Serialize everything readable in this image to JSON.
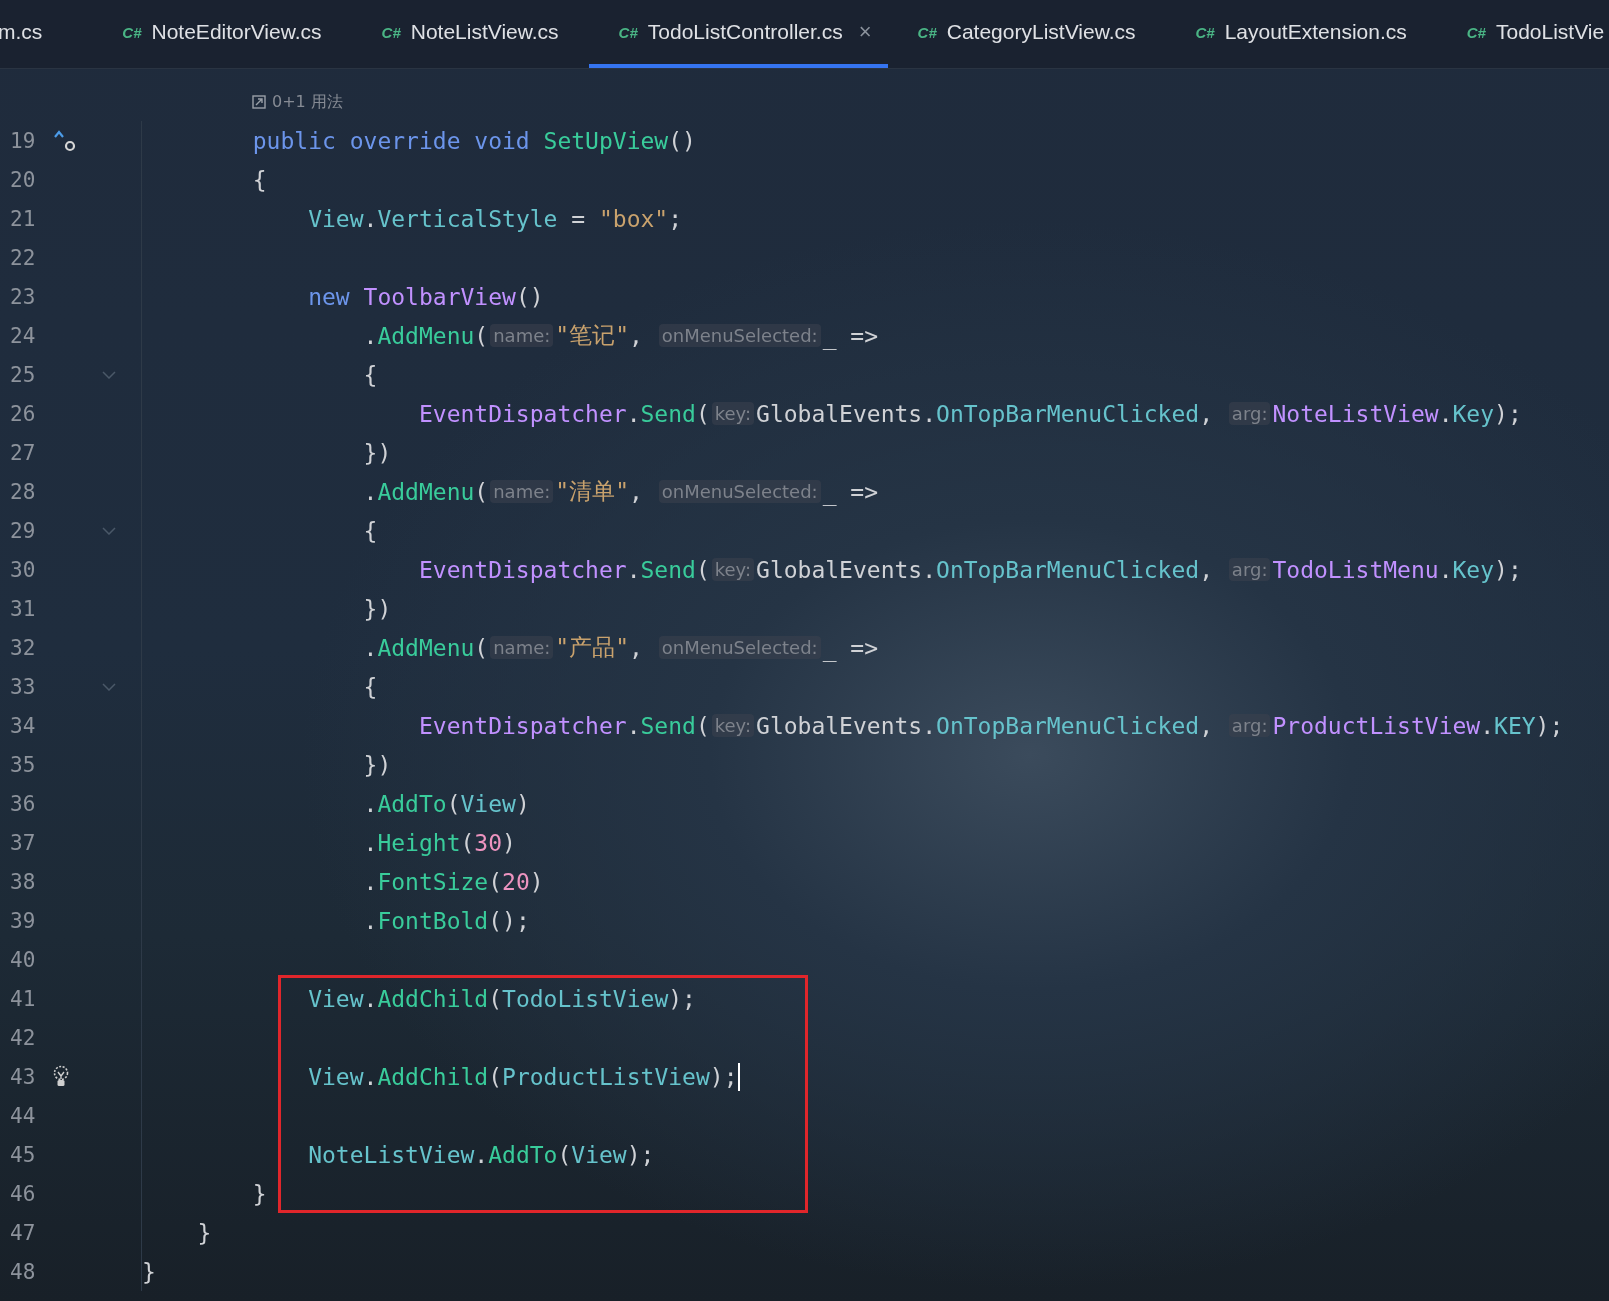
{
  "tabs": [
    {
      "label": "m.cs",
      "selected": false
    },
    {
      "label": "NoteEditorView.cs",
      "badge": "C#",
      "selected": false
    },
    {
      "label": "NoteListView.cs",
      "badge": "C#",
      "selected": false
    },
    {
      "label": "TodoListController.cs",
      "badge": "C#",
      "selected": true,
      "close": "×"
    },
    {
      "label": "CategoryListView.cs",
      "badge": "C#",
      "selected": false
    },
    {
      "label": "LayoutExtension.cs",
      "badge": "C#",
      "selected": false
    },
    {
      "label": "TodoListVie",
      "badge": "C#",
      "selected": false
    }
  ],
  "usage_hint": {
    "text": "0+1 用法"
  },
  "lines": [
    {
      "number": "19",
      "kind": "override",
      "boxed": false,
      "tokens": [
        {
          "kind": "kw",
          "text": "        public override void "
        },
        {
          "kind": "method",
          "text": "SetUpView"
        },
        {
          "kind": "plain",
          "text": "()"
        }
      ]
    },
    {
      "number": "20",
      "kind": "plain",
      "boxed": false,
      "tokens": [
        {
          "kind": "plain",
          "text": "        {"
        }
      ]
    },
    {
      "number": "21",
      "kind": "plain",
      "boxed": false,
      "tokens": [
        {
          "kind": "field",
          "text": "            View"
        },
        {
          "kind": "plain",
          "text": "."
        },
        {
          "kind": "field",
          "text": "VerticalStyle"
        },
        {
          "kind": "plain",
          "text": " = "
        },
        {
          "kind": "str",
          "text": "\"box\""
        },
        {
          "kind": "plain",
          "text": ";"
        }
      ]
    },
    {
      "number": "22",
      "kind": "plain",
      "boxed": false
    },
    {
      "number": "23",
      "kind": "plain",
      "boxed": false,
      "tokens": [
        {
          "kind": "kw",
          "text": "            new "
        },
        {
          "kind": "type",
          "text": "ToolbarView"
        },
        {
          "kind": "plain",
          "text": "()"
        }
      ]
    },
    {
      "number": "24",
      "kind": "plain",
      "boxed": false,
      "tokens": [
        {
          "kind": "plain",
          "text": "                ."
        },
        {
          "kind": "method",
          "text": "AddMenu"
        },
        {
          "kind": "plain",
          "text": "("
        },
        {
          "kind": "hint",
          "text": "name:"
        },
        {
          "kind": "str",
          "text": "\"笔记\""
        },
        {
          "kind": "plain",
          "text": ", "
        },
        {
          "kind": "hint",
          "text": "onMenuSelected:"
        },
        {
          "kind": "plain",
          "text": "_ =>"
        }
      ]
    },
    {
      "number": "25",
      "kind": "fold",
      "boxed": false,
      "tokens": [
        {
          "kind": "plain",
          "text": "                {"
        }
      ]
    },
    {
      "number": "26",
      "kind": "plain",
      "boxed": false,
      "tokens": [
        {
          "kind": "type",
          "text": "                    EventDispatcher"
        },
        {
          "kind": "plain",
          "text": "."
        },
        {
          "kind": "method",
          "text": "Send"
        },
        {
          "kind": "plain",
          "text": "("
        },
        {
          "kind": "hint",
          "text": "key:"
        },
        {
          "kind": "plain",
          "text": "GlobalEvents."
        },
        {
          "kind": "field",
          "text": "OnTopBarMenuClicked"
        },
        {
          "kind": "plain",
          "text": ", "
        },
        {
          "kind": "hint",
          "text": "arg:"
        },
        {
          "kind": "type",
          "text": "NoteListView"
        },
        {
          "kind": "plain",
          "text": "."
        },
        {
          "kind": "field",
          "text": "Key"
        },
        {
          "kind": "plain",
          "text": ");"
        }
      ]
    },
    {
      "number": "27",
      "kind": "plain",
      "boxed": false,
      "tokens": [
        {
          "kind": "plain",
          "text": "                })"
        }
      ]
    },
    {
      "number": "28",
      "kind": "plain",
      "boxed": false,
      "tokens": [
        {
          "kind": "plain",
          "text": "                ."
        },
        {
          "kind": "method",
          "text": "AddMenu"
        },
        {
          "kind": "plain",
          "text": "("
        },
        {
          "kind": "hint",
          "text": "name:"
        },
        {
          "kind": "str",
          "text": "\"清单\""
        },
        {
          "kind": "plain",
          "text": ", "
        },
        {
          "kind": "hint",
          "text": "onMenuSelected:"
        },
        {
          "kind": "plain",
          "text": "_ =>"
        }
      ]
    },
    {
      "number": "29",
      "kind": "fold",
      "boxed": false,
      "tokens": [
        {
          "kind": "plain",
          "text": "                {"
        }
      ]
    },
    {
      "number": "30",
      "kind": "plain",
      "boxed": false,
      "tokens": [
        {
          "kind": "type",
          "text": "                    EventDispatcher"
        },
        {
          "kind": "plain",
          "text": "."
        },
        {
          "kind": "method",
          "text": "Send"
        },
        {
          "kind": "plain",
          "text": "("
        },
        {
          "kind": "hint",
          "text": "key:"
        },
        {
          "kind": "plain",
          "text": "GlobalEvents."
        },
        {
          "kind": "field",
          "text": "OnTopBarMenuClicked"
        },
        {
          "kind": "plain",
          "text": ", "
        },
        {
          "kind": "hint",
          "text": "arg:"
        },
        {
          "kind": "type",
          "text": "TodoListMenu"
        },
        {
          "kind": "plain",
          "text": "."
        },
        {
          "kind": "field",
          "text": "Key"
        },
        {
          "kind": "plain",
          "text": ");"
        }
      ]
    },
    {
      "number": "31",
      "kind": "plain",
      "boxed": false,
      "tokens": [
        {
          "kind": "plain",
          "text": "                })"
        }
      ]
    },
    {
      "number": "32",
      "kind": "plain",
      "boxed": false,
      "tokens": [
        {
          "kind": "plain",
          "text": "                ."
        },
        {
          "kind": "method",
          "text": "AddMenu"
        },
        {
          "kind": "plain",
          "text": "("
        },
        {
          "kind": "hint",
          "text": "name:"
        },
        {
          "kind": "str",
          "text": "\"产品\""
        },
        {
          "kind": "plain",
          "text": ", "
        },
        {
          "kind": "hint",
          "text": "onMenuSelected:"
        },
        {
          "kind": "plain",
          "text": "_ =>"
        }
      ]
    },
    {
      "number": "33",
      "kind": "fold",
      "boxed": false,
      "tokens": [
        {
          "kind": "plain",
          "text": "                {"
        }
      ]
    },
    {
      "number": "34",
      "kind": "plain",
      "boxed": false,
      "tokens": [
        {
          "kind": "type",
          "text": "                    EventDispatcher"
        },
        {
          "kind": "plain",
          "text": "."
        },
        {
          "kind": "method",
          "text": "Send"
        },
        {
          "kind": "plain",
          "text": "("
        },
        {
          "kind": "hint",
          "text": "key:"
        },
        {
          "kind": "plain",
          "text": "GlobalEvents."
        },
        {
          "kind": "field",
          "text": "OnTopBarMenuClicked"
        },
        {
          "kind": "plain",
          "text": ", "
        },
        {
          "kind": "hint",
          "text": "arg:"
        },
        {
          "kind": "type",
          "text": "ProductListView"
        },
        {
          "kind": "plain",
          "text": "."
        },
        {
          "kind": "field",
          "text": "KEY"
        },
        {
          "kind": "plain",
          "text": ");"
        }
      ]
    },
    {
      "number": "35",
      "kind": "plain",
      "boxed": false,
      "tokens": [
        {
          "kind": "plain",
          "text": "                })"
        }
      ]
    },
    {
      "number": "36",
      "kind": "plain",
      "boxed": false,
      "tokens": [
        {
          "kind": "plain",
          "text": "                ."
        },
        {
          "kind": "method",
          "text": "AddTo"
        },
        {
          "kind": "plain",
          "text": "("
        },
        {
          "kind": "field",
          "text": "View"
        },
        {
          "kind": "plain",
          "text": ")"
        }
      ]
    },
    {
      "number": "37",
      "kind": "plain",
      "boxed": false,
      "tokens": [
        {
          "kind": "plain",
          "text": "                ."
        },
        {
          "kind": "method",
          "text": "Height"
        },
        {
          "kind": "plain",
          "text": "("
        },
        {
          "kind": "num",
          "text": "30"
        },
        {
          "kind": "plain",
          "text": ")"
        }
      ]
    },
    {
      "number": "38",
      "kind": "plain",
      "boxed": false,
      "tokens": [
        {
          "kind": "plain",
          "text": "                ."
        },
        {
          "kind": "method",
          "text": "FontSize"
        },
        {
          "kind": "plain",
          "text": "("
        },
        {
          "kind": "num",
          "text": "20"
        },
        {
          "kind": "plain",
          "text": ")"
        }
      ]
    },
    {
      "number": "39",
      "kind": "plain",
      "boxed": false,
      "tokens": [
        {
          "kind": "plain",
          "text": "                ."
        },
        {
          "kind": "method",
          "text": "FontBold"
        },
        {
          "kind": "plain",
          "text": "();"
        }
      ]
    },
    {
      "number": "40",
      "kind": "plain",
      "boxed": false
    },
    {
      "number": "41",
      "kind": "plain",
      "boxed": true,
      "tokens": [
        {
          "kind": "field",
          "text": "            View"
        },
        {
          "kind": "plain",
          "text": "."
        },
        {
          "kind": "method",
          "text": "AddChild"
        },
        {
          "kind": "plain",
          "text": "("
        },
        {
          "kind": "field",
          "text": "TodoListView"
        },
        {
          "kind": "plain",
          "text": ");"
        }
      ]
    },
    {
      "number": "42",
      "kind": "plain",
      "boxed": true
    },
    {
      "number": "43",
      "kind": "bulb",
      "boxed": true,
      "caret": true,
      "tokens": [
        {
          "kind": "field",
          "text": "            View"
        },
        {
          "kind": "plain",
          "text": "."
        },
        {
          "kind": "method",
          "text": "AddChild"
        },
        {
          "kind": "plain",
          "text": "("
        },
        {
          "kind": "field",
          "text": "ProductListView"
        },
        {
          "kind": "plain",
          "text": ");"
        }
      ]
    },
    {
      "number": "44",
      "kind": "plain",
      "boxed": true
    },
    {
      "number": "45",
      "kind": "plain",
      "boxed": true,
      "tokens": [
        {
          "kind": "field",
          "text": "            NoteListView"
        },
        {
          "kind": "plain",
          "text": "."
        },
        {
          "kind": "method",
          "text": "AddTo"
        },
        {
          "kind": "plain",
          "text": "("
        },
        {
          "kind": "field",
          "text": "View"
        },
        {
          "kind": "plain",
          "text": ");"
        }
      ]
    },
    {
      "number": "46",
      "kind": "plain",
      "boxed": true,
      "tokens": [
        {
          "kind": "plain",
          "text": "        }"
        }
      ]
    },
    {
      "number": "47",
      "kind": "plain",
      "boxed": false,
      "tokens": [
        {
          "kind": "plain",
          "text": "    }"
        }
      ]
    },
    {
      "number": "48",
      "kind": "plain",
      "boxed": false,
      "tokens": [
        {
          "kind": "plain",
          "text": "}"
        }
      ]
    }
  ]
}
